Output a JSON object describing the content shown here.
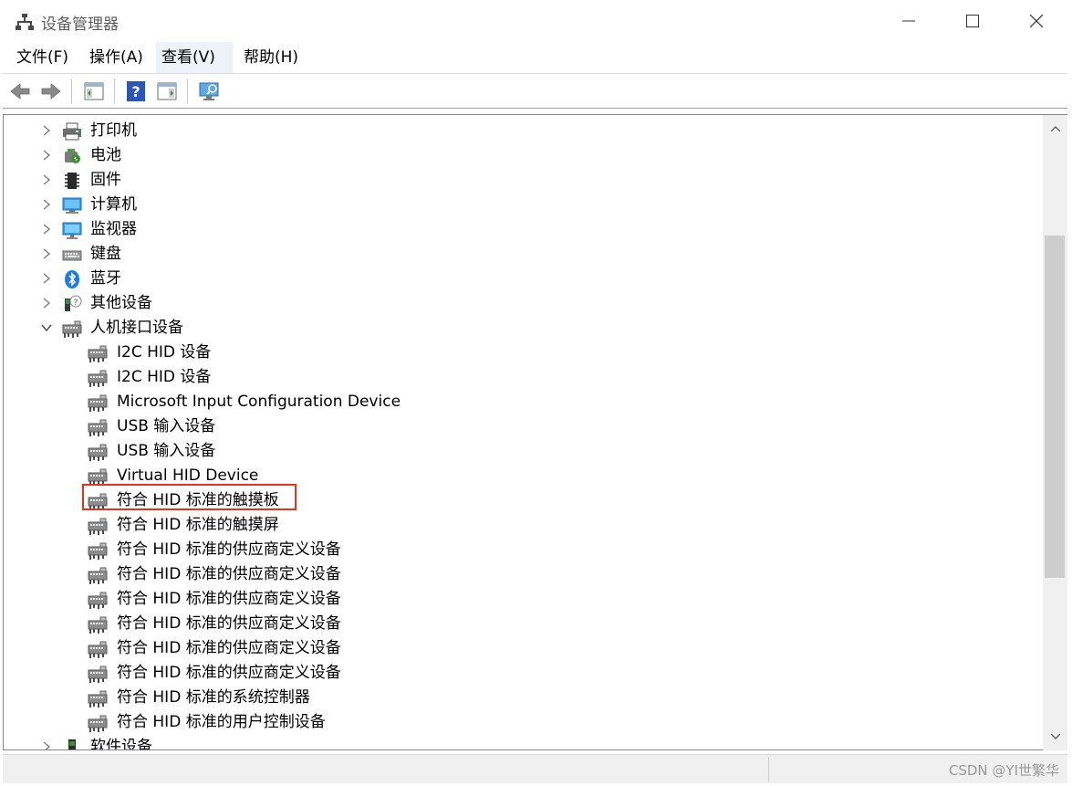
{
  "window": {
    "title": "设备管理器"
  },
  "menu": {
    "items": [
      {
        "label": "文件(F)"
      },
      {
        "label": "操作(A)"
      },
      {
        "label": "查看(V)"
      },
      {
        "label": "帮助(H)"
      }
    ]
  },
  "tree": {
    "categories": [
      {
        "label": "打印机",
        "icon": "printer-icon",
        "expanded": false
      },
      {
        "label": "电池",
        "icon": "battery-icon",
        "expanded": false
      },
      {
        "label": "固件",
        "icon": "firmware-icon",
        "expanded": false
      },
      {
        "label": "计算机",
        "icon": "computer-icon",
        "expanded": false
      },
      {
        "label": "监视器",
        "icon": "monitor-icon",
        "expanded": false
      },
      {
        "label": "键盘",
        "icon": "keyboard-icon",
        "expanded": false
      },
      {
        "label": "蓝牙",
        "icon": "bluetooth-icon",
        "expanded": false
      },
      {
        "label": "其他设备",
        "icon": "unknown-device-icon",
        "expanded": false
      },
      {
        "label": "人机接口设备",
        "icon": "hid-icon",
        "expanded": true
      }
    ],
    "hid_children": [
      "I2C HID 设备",
      "I2C HID 设备",
      "Microsoft Input Configuration Device",
      "USB 输入设备",
      "USB 输入设备",
      "Virtual HID Device",
      "符合 HID 标准的触摸板",
      "符合 HID 标准的触摸屏",
      "符合 HID 标准的供应商定义设备",
      "符合 HID 标准的供应商定义设备",
      "符合 HID 标准的供应商定义设备",
      "符合 HID 标准的供应商定义设备",
      "符合 HID 标准的供应商定义设备",
      "符合 HID 标准的供应商定义设备",
      "符合 HID 标准的系统控制器",
      "符合 HID 标准的用户控制设备"
    ],
    "highlighted_item": "符合 HID 标准的触摸板",
    "next_category": {
      "label": "软件设备",
      "icon": "software-device-icon"
    }
  },
  "watermark": "CSDN @YI世繁华",
  "colors": {
    "highlight_border": "#e5341c",
    "menu_active_bg": "#eef3f9"
  }
}
